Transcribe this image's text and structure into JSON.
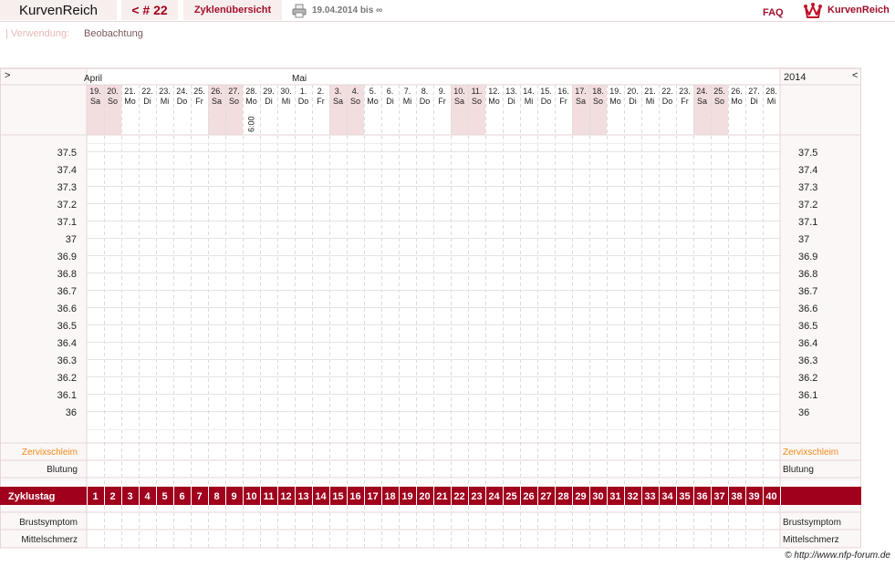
{
  "header": {
    "brand": "KurvenReich",
    "cycle_nav": "< # 22",
    "overview_label": "Zyklenübersicht",
    "print_icon": "printer-icon",
    "date_range": "19.04.2014 bis ∞",
    "faq_label": "FAQ",
    "logo_text": "KurvenReich",
    "logo_icon": "crown-icon"
  },
  "usage": {
    "label": "| Verwendung:",
    "value": "Beobachtung"
  },
  "nav": {
    "prev": ">",
    "next": "<",
    "year": "2014"
  },
  "months": [
    {
      "label": "April",
      "day_index": 0
    },
    {
      "label": "Mai",
      "day_index": 12
    }
  ],
  "days": [
    {
      "date": "19.",
      "weekday": "Sa",
      "weekend": true
    },
    {
      "date": "20.",
      "weekday": "So",
      "weekend": true
    },
    {
      "date": "21.",
      "weekday": "Mo",
      "weekend": false
    },
    {
      "date": "22.",
      "weekday": "Di",
      "weekend": false
    },
    {
      "date": "23.",
      "weekday": "Mi",
      "weekend": false
    },
    {
      "date": "24.",
      "weekday": "Do",
      "weekend": false
    },
    {
      "date": "25.",
      "weekday": "Fr",
      "weekend": false
    },
    {
      "date": "26.",
      "weekday": "Sa",
      "weekend": true
    },
    {
      "date": "27.",
      "weekday": "So",
      "weekend": true
    },
    {
      "date": "28.",
      "weekday": "Mo",
      "weekend": false,
      "time": "6:00"
    },
    {
      "date": "29.",
      "weekday": "Di",
      "weekend": false
    },
    {
      "date": "30.",
      "weekday": "Mi",
      "weekend": false
    },
    {
      "date": "1.",
      "weekday": "Do",
      "weekend": false
    },
    {
      "date": "2.",
      "weekday": "Fr",
      "weekend": false
    },
    {
      "date": "3.",
      "weekday": "Sa",
      "weekend": true
    },
    {
      "date": "4.",
      "weekday": "So",
      "weekend": true
    },
    {
      "date": "5.",
      "weekday": "Mo",
      "weekend": false
    },
    {
      "date": "6.",
      "weekday": "Di",
      "weekend": false
    },
    {
      "date": "7.",
      "weekday": "Mi",
      "weekend": false
    },
    {
      "date": "8.",
      "weekday": "Do",
      "weekend": false
    },
    {
      "date": "9.",
      "weekday": "Fr",
      "weekend": false
    },
    {
      "date": "10.",
      "weekday": "Sa",
      "weekend": true
    },
    {
      "date": "11.",
      "weekday": "So",
      "weekend": true
    },
    {
      "date": "12.",
      "weekday": "Mo",
      "weekend": false
    },
    {
      "date": "13.",
      "weekday": "Di",
      "weekend": false
    },
    {
      "date": "14.",
      "weekday": "Mi",
      "weekend": false
    },
    {
      "date": "15.",
      "weekday": "Do",
      "weekend": false
    },
    {
      "date": "16.",
      "weekday": "Fr",
      "weekend": false
    },
    {
      "date": "17.",
      "weekday": "Sa",
      "weekend": true
    },
    {
      "date": "18.",
      "weekday": "So",
      "weekend": true
    },
    {
      "date": "19.",
      "weekday": "Mo",
      "weekend": false
    },
    {
      "date": "20.",
      "weekday": "Di",
      "weekend": false
    },
    {
      "date": "21.",
      "weekday": "Mi",
      "weekend": false
    },
    {
      "date": "22.",
      "weekday": "Do",
      "weekend": false
    },
    {
      "date": "23.",
      "weekday": "Fr",
      "weekend": false
    },
    {
      "date": "24.",
      "weekday": "Sa",
      "weekend": true
    },
    {
      "date": "25.",
      "weekday": "So",
      "weekend": true
    },
    {
      "date": "26.",
      "weekday": "Mo",
      "weekend": false
    },
    {
      "date": "27.",
      "weekday": "Di",
      "weekend": false
    },
    {
      "date": "28.",
      "weekday": "Mi",
      "weekend": false
    }
  ],
  "temperatures": [
    "37.5",
    "37.4",
    "37.3",
    "37.2",
    "37.1",
    "37",
    "36.9",
    "36.8",
    "36.7",
    "36.6",
    "36.5",
    "36.4",
    "36.3",
    "36.2",
    "36.1",
    "36"
  ],
  "rows": {
    "cervix": "Zervixschleim",
    "bleeding": "Blutung",
    "cycle_day": "Zyklustag",
    "breast": "Brustsymptom",
    "midpain": "Mittelschmerz"
  },
  "cycle_days": [
    "1",
    "2",
    "3",
    "4",
    "5",
    "6",
    "7",
    "8",
    "9",
    "10",
    "11",
    "12",
    "13",
    "14",
    "15",
    "16",
    "17",
    "18",
    "19",
    "20",
    "21",
    "22",
    "23",
    "24",
    "25",
    "26",
    "27",
    "28",
    "29",
    "30",
    "31",
    "32",
    "33",
    "34",
    "35",
    "36",
    "37",
    "38",
    "39",
    "40"
  ],
  "colors": {
    "accent": "#a0001c",
    "cervix": "#f08a18",
    "weekend": "#f2dede",
    "panel": "#f8f2f2"
  },
  "footer": "© http://www.nfp-forum.de"
}
